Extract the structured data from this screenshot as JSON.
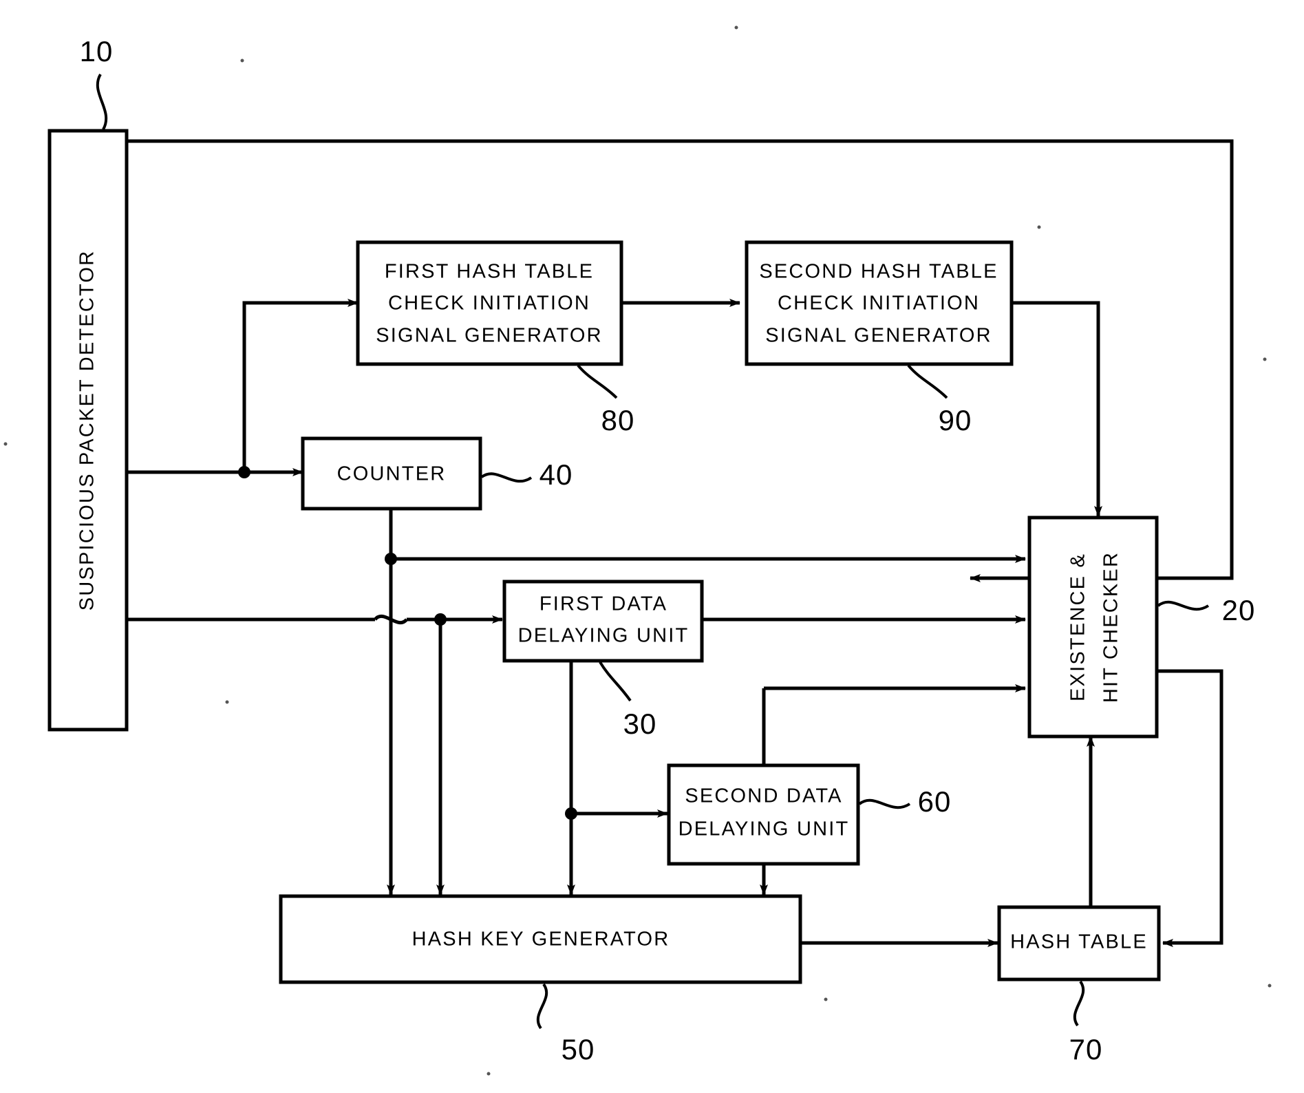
{
  "figure": {
    "kind": "patent-block-diagram",
    "background": "#ffffff",
    "ink": "#000000"
  },
  "blocks": {
    "suspicious_packet_detector": {
      "label": "SUSPICIOUS PACKET DETECTOR",
      "ref": "10",
      "orientation": "vertical"
    },
    "first_hash_sig_gen": {
      "line1": "FIRST HASH TABLE",
      "line2": "CHECK INITIATION",
      "line3": "SIGNAL GENERATOR",
      "ref": "80"
    },
    "second_hash_sig_gen": {
      "line1": "SECOND HASH TABLE",
      "line2": "CHECK INITIATION",
      "line3": "SIGNAL GENERATOR",
      "ref": "90"
    },
    "counter": {
      "label": "COUNTER",
      "ref": "40"
    },
    "first_data_delaying_unit": {
      "line1": "FIRST DATA",
      "line2": "DELAYING UNIT",
      "ref": "30"
    },
    "second_data_delaying_unit": {
      "line1": "SECOND DATA",
      "line2": "DELAYING UNIT",
      "ref": "60"
    },
    "hash_key_generator": {
      "label": "HASH KEY GENERATOR",
      "ref": "50"
    },
    "hash_table": {
      "label": "HASH TABLE",
      "ref": "70"
    },
    "existence_hit_checker": {
      "line1": "EXISTENCE &",
      "line2": "HIT CHECKER",
      "ref": "20",
      "orientation": "vertical"
    }
  },
  "ref_labels": [
    "10",
    "20",
    "30",
    "40",
    "50",
    "60",
    "70",
    "80",
    "90"
  ]
}
